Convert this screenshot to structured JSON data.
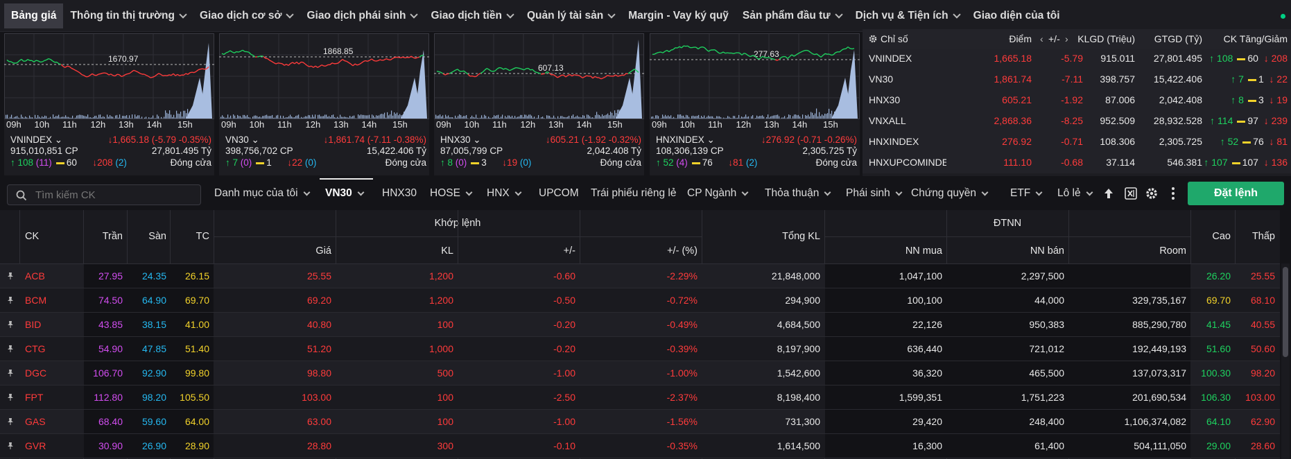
{
  "nav": {
    "items": [
      {
        "label": "Bảng giá",
        "active": true,
        "chevron": false
      },
      {
        "label": "Thông tin thị trường",
        "chevron": true
      },
      {
        "label": "Giao dịch cơ sở",
        "chevron": true
      },
      {
        "label": "Giao dịch phái sinh",
        "chevron": true
      },
      {
        "label": "Giao dịch tiền",
        "chevron": true
      },
      {
        "label": "Quản lý tài sản",
        "chevron": true
      },
      {
        "label": "Margin - Vay ký quỹ",
        "chevron": false
      },
      {
        "label": "Sản phẩm đầu tư",
        "chevron": true
      },
      {
        "label": "Dịch vụ & Tiện ích",
        "chevron": true
      },
      {
        "label": "Giao diện của tôi",
        "chevron": false
      }
    ]
  },
  "mini_charts": [
    {
      "ref_label": "1670.97",
      "times": [
        "09h",
        "10h",
        "11h",
        "12h",
        "13h",
        "14h",
        "15h"
      ],
      "name": "VNINDEX",
      "change": "↓1,665.18 (-5.79 -0.35%)",
      "volume": "915,010,851 CP",
      "value": "27,801.495 Tỷ",
      "up": "↑ 108",
      "up_ceiling": "(11)",
      "flat": "60",
      "down": "↓208",
      "down_floor": "(2)",
      "status": "Đóng cửa"
    },
    {
      "ref_label": "1868.85",
      "times": [
        "09h",
        "10h",
        "11h",
        "12h",
        "13h",
        "14h",
        "15h"
      ],
      "name": "VN30",
      "change": "↓1,861.74 (-7.11 -0.38%)",
      "volume": "398,756,702 CP",
      "value": "15,422.406 Tỷ",
      "up": "↑ 7",
      "up_ceiling": "(0)",
      "flat": "1",
      "down": "↓22",
      "down_floor": "(0)",
      "status": "Đóng cửa"
    },
    {
      "ref_label": "607.13",
      "times": [
        "09h",
        "10h",
        "11h",
        "12h",
        "13h",
        "14h",
        "15h"
      ],
      "name": "HNX30",
      "change": "↓605.21 (-1.92 -0.32%)",
      "volume": "87,005,799 CP",
      "value": "2,042.408 Tỷ",
      "up": "↑ 8",
      "up_ceiling": "(0)",
      "flat": "3",
      "down": "↓19",
      "down_floor": "(0)",
      "status": "Đóng cửa"
    },
    {
      "ref_label": "277.63",
      "times": [
        "09h",
        "10h",
        "11h",
        "12h",
        "13h",
        "14h",
        "15h"
      ],
      "name": "HNXINDEX",
      "change": "↓276.92 (-0.71 -0.26%)",
      "volume": "108,306,139 CP",
      "value": "2,305.725 Tỷ",
      "up": "↑ 52",
      "up_ceiling": "(4)",
      "flat": "76",
      "down": "↓81",
      "down_floor": "(2)",
      "status": "Đóng cửa"
    }
  ],
  "index_table": {
    "headers": {
      "name": "Chỉ số",
      "point": "Điểm",
      "change": "+/-",
      "volume": "KLGD (Triệu)",
      "value": "GTGD (Tỷ)",
      "breadth": "CK Tăng/Giảm"
    },
    "rows": [
      {
        "name": "VNINDEX",
        "point": "1,665.18",
        "change": "-5.79",
        "volume": "915.011",
        "value": "27,801.495",
        "up": "↑ 108",
        "flat": "60",
        "down": "↓ 208"
      },
      {
        "name": "VN30",
        "point": "1,861.74",
        "change": "-7.11",
        "volume": "398.757",
        "value": "15,422.406",
        "up": "↑ 7",
        "flat": "1",
        "down": "↓ 22"
      },
      {
        "name": "HNX30",
        "point": "605.21",
        "change": "-1.92",
        "volume": "87.006",
        "value": "2,042.408",
        "up": "↑ 8",
        "flat": "3",
        "down": "↓ 19"
      },
      {
        "name": "VNXALL",
        "point": "2,868.36",
        "change": "-8.25",
        "volume": "952.509",
        "value": "28,932.528",
        "up": "↑ 114",
        "flat": "97",
        "down": "↓ 239"
      },
      {
        "name": "HNXINDEX",
        "point": "276.92",
        "change": "-0.71",
        "volume": "108.306",
        "value": "2,305.725",
        "up": "↑ 52",
        "flat": "76",
        "down": "↓ 81"
      },
      {
        "name": "HNXUPCOMINDE",
        "point": "111.10",
        "change": "-0.68",
        "volume": "37.114",
        "value": "546.381",
        "up": "↑ 107",
        "flat": "107",
        "down": "↓ 136"
      }
    ]
  },
  "toolbar": {
    "search_placeholder": "Tìm kiếm CK",
    "tabs": [
      {
        "label": "Danh mục của tôi",
        "chevron": true
      },
      {
        "label": "VN30",
        "chevron": true,
        "active": true
      },
      {
        "label": "HNX30",
        "chevron": false
      },
      {
        "label": "HOSE",
        "chevron": true
      },
      {
        "label": "HNX",
        "chevron": true
      },
      {
        "label": "UPCOM",
        "chevron": false
      },
      {
        "label": "Trái phiếu riêng lẻ",
        "chevron": false
      },
      {
        "label": "CP Ngành",
        "chevron": true
      },
      {
        "label": "Thỏa thuận",
        "chevron": true
      },
      {
        "label": "Phái sinh",
        "chevron": true
      },
      {
        "label": "Chứng quyền",
        "chevron": true
      },
      {
        "label": "ETF",
        "chevron": true
      },
      {
        "label": "Lô lẻ",
        "chevron": true
      }
    ],
    "order_button": "Đặt lệnh"
  },
  "table": {
    "headers": {
      "ck": "CK",
      "ceiling": "Trần",
      "floor": "Sàn",
      "ref": "TC",
      "match_group": "Khớp lệnh",
      "price": "Giá",
      "vol": "KL",
      "change": "+/-",
      "change_pct": "+/- (%)",
      "total_vol": "Tổng KL",
      "foreign_group": "ĐTNN",
      "nn_buy": "NN mua",
      "nn_sell": "NN bán",
      "room": "Room",
      "high": "Cao",
      "low": "Thấp"
    },
    "rows": [
      {
        "ck": "ACB",
        "ceiling": "27.95",
        "floor": "24.35",
        "ref": "26.15",
        "price": "25.55",
        "vol": "1,200",
        "change": "-0.60",
        "change_pct": "-2.29%",
        "total_vol": "21,848,000",
        "nn_buy": "1,047,100",
        "nn_sell": "2,297,500",
        "room": "",
        "high": "26.20",
        "high_color": "green",
        "low": "25.55"
      },
      {
        "ck": "BCM",
        "ceiling": "74.50",
        "floor": "64.90",
        "ref": "69.70",
        "price": "69.20",
        "vol": "1,200",
        "change": "-0.50",
        "change_pct": "-0.72%",
        "total_vol": "294,900",
        "nn_buy": "100,100",
        "nn_sell": "44,000",
        "room": "329,735,167",
        "high": "69.70",
        "high_color": "yellow",
        "low": "68.10"
      },
      {
        "ck": "BID",
        "ceiling": "43.85",
        "floor": "38.15",
        "ref": "41.00",
        "price": "40.80",
        "vol": "100",
        "change": "-0.20",
        "change_pct": "-0.49%",
        "total_vol": "4,684,500",
        "nn_buy": "22,126",
        "nn_sell": "950,383",
        "room": "885,290,780",
        "high": "41.45",
        "high_color": "green",
        "low": "40.55"
      },
      {
        "ck": "CTG",
        "ceiling": "54.90",
        "floor": "47.85",
        "ref": "51.40",
        "price": "51.20",
        "vol": "1,000",
        "change": "-0.20",
        "change_pct": "-0.39%",
        "total_vol": "8,197,900",
        "nn_buy": "636,440",
        "nn_sell": "721,012",
        "room": "192,449,193",
        "high": "51.60",
        "high_color": "green",
        "low": "50.60"
      },
      {
        "ck": "DGC",
        "ceiling": "106.70",
        "floor": "92.90",
        "ref": "99.80",
        "price": "98.80",
        "vol": "500",
        "change": "-1.00",
        "change_pct": "-1.00%",
        "total_vol": "1,542,600",
        "nn_buy": "36,320",
        "nn_sell": "465,500",
        "room": "137,073,317",
        "high": "100.30",
        "high_color": "green",
        "low": "98.20"
      },
      {
        "ck": "FPT",
        "ceiling": "112.80",
        "floor": "98.20",
        "ref": "105.50",
        "price": "103.00",
        "vol": "100",
        "change": "-2.50",
        "change_pct": "-2.37%",
        "total_vol": "8,198,400",
        "nn_buy": "1,599,351",
        "nn_sell": "1,751,223",
        "room": "201,690,534",
        "high": "106.30",
        "high_color": "green",
        "low": "103.00"
      },
      {
        "ck": "GAS",
        "ceiling": "68.40",
        "floor": "59.60",
        "ref": "64.00",
        "price": "63.00",
        "vol": "100",
        "change": "-1.00",
        "change_pct": "-1.56%",
        "total_vol": "731,300",
        "nn_buy": "29,420",
        "nn_sell": "248,400",
        "room": "1,106,374,082",
        "high": "64.10",
        "high_color": "green",
        "low": "62.90"
      },
      {
        "ck": "GVR",
        "ceiling": "30.90",
        "floor": "26.90",
        "ref": "28.90",
        "price": "28.80",
        "vol": "300",
        "change": "-0.10",
        "change_pct": "-0.35%",
        "total_vol": "1,614,500",
        "nn_buy": "16,300",
        "nn_sell": "61,400",
        "room": "504,111,050",
        "high": "29.00",
        "high_color": "green",
        "low": "28.60"
      }
    ]
  },
  "colors": {
    "up": "#1ed15f",
    "down": "#ff3b3b",
    "ref": "#f2d22a",
    "ceiling": "#d24df0",
    "floor": "#25b8f0",
    "accent": "#1fa86b"
  },
  "icons": [
    "pin-icon",
    "search-icon",
    "gear-icon",
    "excel-icon",
    "arrow-up-icon",
    "more-icon"
  ]
}
